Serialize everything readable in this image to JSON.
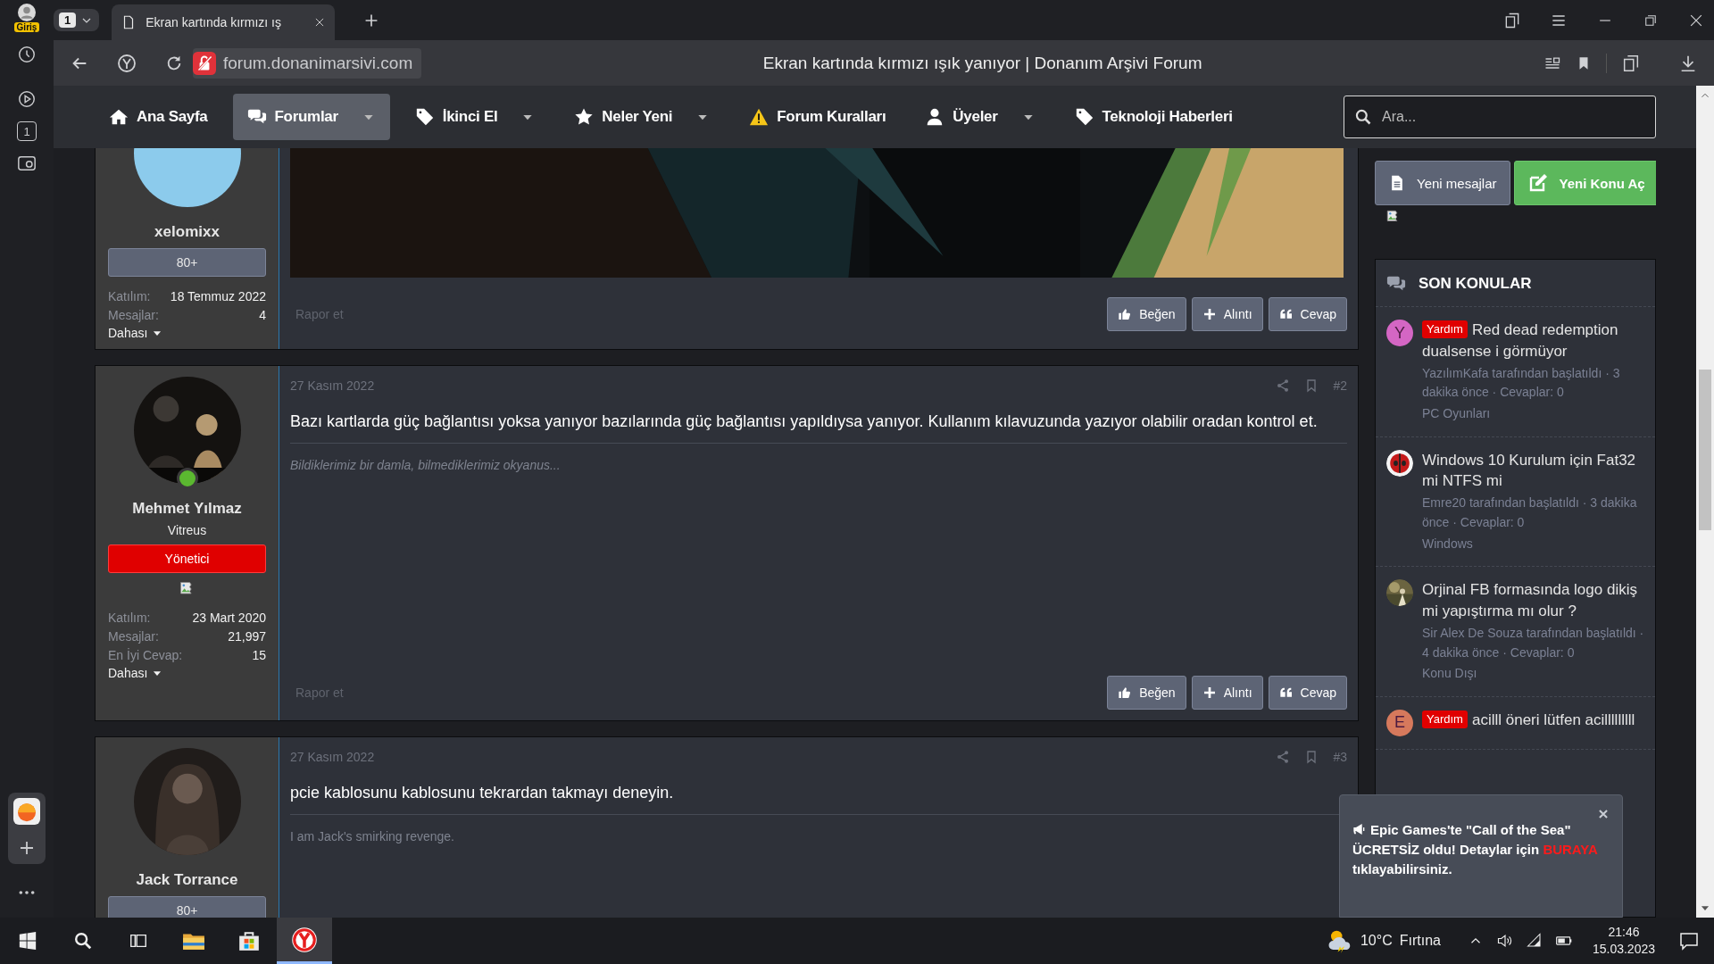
{
  "browser": {
    "profile_label": "Giriş",
    "tab_counter": "1",
    "tab_title": "Ekran kartında kırmızı ış",
    "url": "forum.donanimarsivi.com",
    "page_title": "Ekran kartında kırmızı ışık yanıyor | Donanım Arşivi Forum",
    "rail_counter": "1"
  },
  "nav": {
    "items": [
      {
        "label": "Ana Sayfa",
        "kind": "home",
        "selected": false
      },
      {
        "label": "Forumlar",
        "kind": "chat",
        "selected": true,
        "dropdown": true
      },
      {
        "label": "İkinci El",
        "kind": "tag",
        "selected": false,
        "dropdown": true
      },
      {
        "label": "Neler Yeni",
        "kind": "star",
        "selected": false,
        "dropdown": true
      },
      {
        "label": "Forum Kuralları",
        "kind": "warning",
        "selected": false
      },
      {
        "label": "Üyeler",
        "kind": "user",
        "selected": false,
        "dropdown": true
      },
      {
        "label": "Teknoloji Haberleri",
        "kind": "tag",
        "selected": false
      }
    ],
    "search": {
      "placeholder": "Ara..."
    }
  },
  "posts": [
    {
      "user": {
        "name": "xelomixx",
        "avatar": {
          "kind": "blank",
          "color": "#8ccbec"
        },
        "badge": {
          "text": "80+",
          "kind": "rank"
        },
        "stats": [
          {
            "label": "Katılım:",
            "value": "18 Temmuz 2022"
          },
          {
            "label": "Mesajlar:",
            "value": "4"
          }
        ],
        "more": "Dahası"
      },
      "image": {
        "kind": "picture"
      },
      "report": "Rapor et",
      "actions": [
        {
          "label": "Beğen",
          "kind": "like"
        },
        {
          "label": "Alıntı",
          "kind": "quote"
        },
        {
          "label": "Cevap",
          "kind": "reply"
        }
      ]
    },
    {
      "user": {
        "name": "Mehmet Yılmaz",
        "avatar": {
          "kind": "picture"
        },
        "online": true,
        "user_title": "Vitreus",
        "badge": {
          "text": "Yönetici",
          "kind": "role"
        },
        "banner_broken": true,
        "stats": [
          {
            "label": "Katılım:",
            "value": "23 Mart 2020"
          },
          {
            "label": "Mesajlar:",
            "value": "21,997"
          },
          {
            "label": "En İyi Cevap:",
            "value": "15"
          }
        ],
        "more": "Dahası"
      },
      "date": "27 Kasım 2022",
      "number": "#2",
      "body": "Bazı kartlarda güç bağlantısı yoksa yanıyor bazılarında güç bağlantısı yapıldıysa yanıyor. Kullanım kılavuzunda yazıyor olabilir oradan kontrol et.",
      "signature": "Bildiklerimiz bir damla, bilmediklerimiz okyanus...",
      "signature_italic": true,
      "report": "Rapor et",
      "actions": [
        {
          "label": "Beğen",
          "kind": "like"
        },
        {
          "label": "Alıntı",
          "kind": "quote"
        },
        {
          "label": "Cevap",
          "kind": "reply"
        }
      ]
    },
    {
      "user": {
        "name": "Jack Torrance",
        "avatar": {
          "kind": "picture"
        },
        "badge": {
          "text": "80+",
          "kind": "rank"
        }
      },
      "date": "27 Kasım 2022",
      "number": "#3",
      "body": "pcie kablosunu kablosunu tekrardan takmayı deneyin.",
      "signature": "I am Jack's smirking revenge.",
      "signature_italic": false
    }
  ],
  "sidebar": {
    "buttons": [
      {
        "label": "Yeni mesajlar",
        "kind": "secondary"
      },
      {
        "label": "Yeni Konu Aç",
        "kind": "primary"
      }
    ],
    "section_title": "SON KONULAR",
    "topics": [
      {
        "avatar": {
          "kind": "letter",
          "letter": "Y",
          "color": "#d466c4"
        },
        "tag": "Yardım",
        "title": "Red dead redemption dualsense i görmüyor",
        "meta": "YazılımKafa tarafından başlatıldı · 3 dakika önce · Cevaplar: 0",
        "forum": "PC Oyunları"
      },
      {
        "avatar": {
          "kind": "picture"
        },
        "title": "Windows 10 Kurulum için Fat32 mi NTFS mi",
        "meta": "Emre20 tarafından başlatıldı · 3 dakika önce · Cevaplar: 0",
        "forum": "Windows"
      },
      {
        "avatar": {
          "kind": "picture"
        },
        "title": "Orjinal FB formasında logo dikiş mi yapıştırma mı olur ?",
        "meta": "Sir Alex De Souza tarafından başlatıldı · 4 dakika önce · Cevaplar: 0",
        "forum": "Konu Dışı"
      },
      {
        "avatar": {
          "kind": "letter",
          "letter": "E",
          "color": "#d6795c"
        },
        "tag": "Yardım",
        "title": "acilll öneri lütfen acilllllllll"
      }
    ]
  },
  "notice": {
    "text_before": "Epic Games'te \"Call of the Sea\" ÜCRETSİZ oldu! Detaylar için ",
    "link": "BURAYA",
    "text_after": " tıklayabilirsiniz."
  },
  "taskbar": {
    "temperature": "10°C",
    "condition": "Fırtına",
    "time": "21:46",
    "date": "15.03.2023"
  }
}
